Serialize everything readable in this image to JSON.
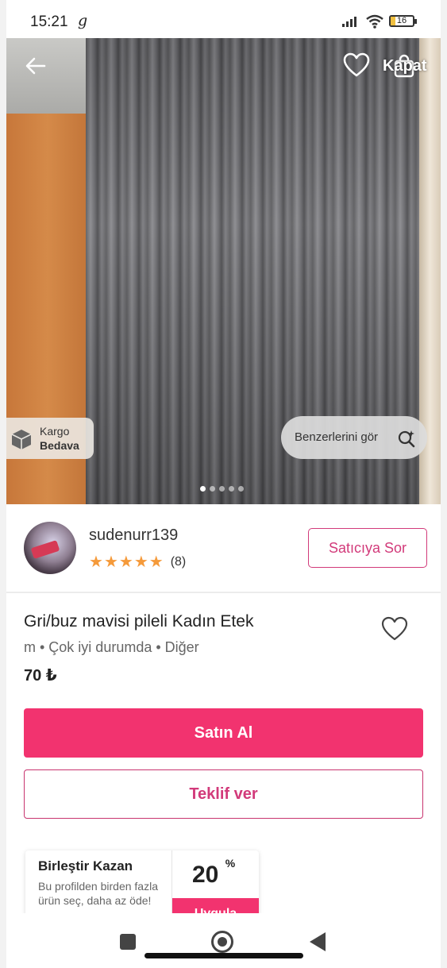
{
  "status_bar": {
    "time": "15:21",
    "notif_glyph": "g",
    "battery": "16"
  },
  "top_bar": {
    "close_label": "Kapat"
  },
  "badges": {
    "cargo_line1": "Kargo",
    "cargo_line2": "Bedava",
    "similar_label": "Benzerlerini gör"
  },
  "carousel": {
    "total": 5,
    "active": 0
  },
  "seller": {
    "username": "sudenurr139",
    "rating_stars": 5,
    "review_count": "(8)",
    "ask_label": "Satıcıya Sor"
  },
  "product": {
    "title": "Gri/buz mavisi pileli Kadın Etek",
    "meta": "m • Çok iyi durumda • Diğer",
    "price": "70 ₺"
  },
  "actions": {
    "buy_label": "Satın Al",
    "offer_label": "Teklif ver"
  },
  "combine": {
    "title": "Birleştir Kazan",
    "desc": "Bu profilden birden fazla ürün seç, daha az öde!",
    "percent": "20",
    "percent_sign": "%",
    "apply_label": "Uygula"
  },
  "colors": {
    "accent": "#f2336f",
    "accent_outline": "#d23a7a",
    "star": "#f59a3a"
  },
  "icons": [
    "back-arrow-icon",
    "heart-icon",
    "bag-icon",
    "box-icon",
    "search-sparkle-icon",
    "heart-outline-icon",
    "square-nav-icon",
    "home-nav-icon",
    "back-nav-icon"
  ]
}
